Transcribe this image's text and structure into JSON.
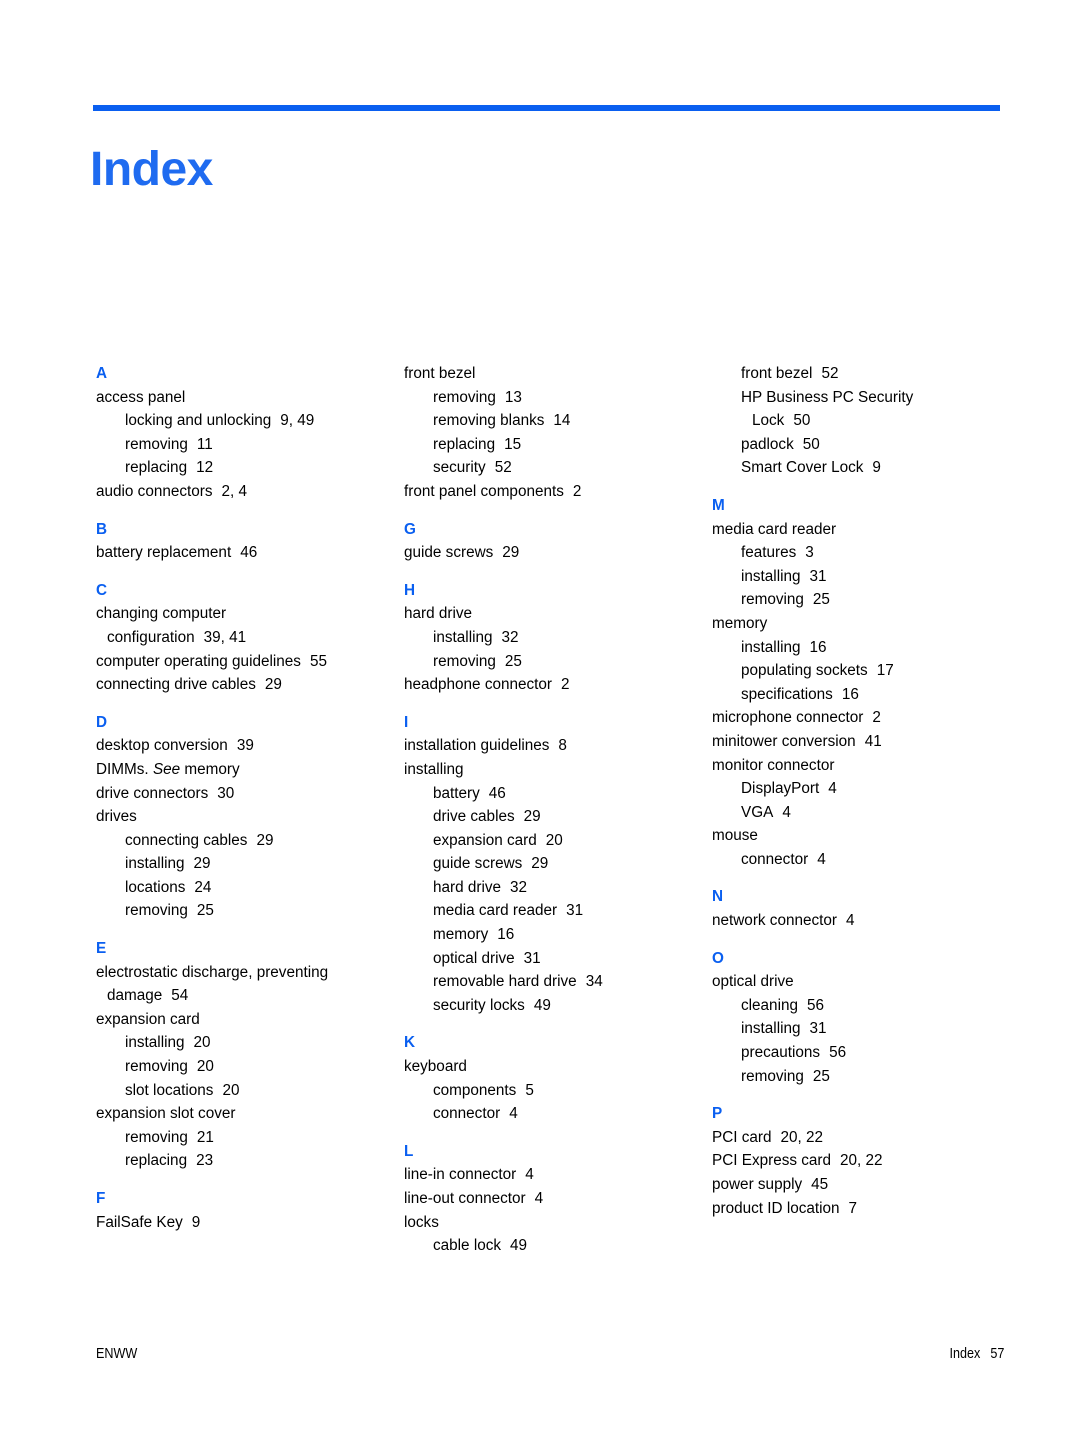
{
  "document": {
    "title": "Index",
    "accent_color": "#0a5ff0",
    "title_color": "#1f6bf0"
  },
  "footer": {
    "left": "ENWW",
    "right_label": "Index",
    "page_number": "57"
  },
  "columns": [
    {
      "id": "column-1",
      "sections": [
        {
          "letter": "A",
          "entries": [
            {
              "level": 1,
              "text": "access panel",
              "pages": ""
            },
            {
              "level": 2,
              "text": "locking and unlocking",
              "pages": "9, 49"
            },
            {
              "level": 2,
              "text": "removing",
              "pages": "11"
            },
            {
              "level": 2,
              "text": "replacing",
              "pages": "12"
            },
            {
              "level": 1,
              "text": "audio connectors",
              "pages": "2, 4"
            }
          ]
        },
        {
          "letter": "B",
          "entries": [
            {
              "level": 1,
              "text": "battery replacement",
              "pages": "46"
            }
          ]
        },
        {
          "letter": "C",
          "entries": [
            {
              "level": 1,
              "text": "changing computer",
              "pages": ""
            },
            {
              "level": 1,
              "wrap": true,
              "text": "configuration",
              "pages": "39, 41"
            },
            {
              "level": 1,
              "text": "computer operating guidelines",
              "pages": "55"
            },
            {
              "level": 1,
              "text": "connecting drive cables",
              "pages": "29"
            }
          ]
        },
        {
          "letter": "D",
          "entries": [
            {
              "level": 1,
              "text": "desktop conversion",
              "pages": "39"
            },
            {
              "level": 1,
              "text": "DIMMs. ",
              "see": "See",
              "text_after": " memory",
              "pages": ""
            },
            {
              "level": 1,
              "text": "drive connectors",
              "pages": "30"
            },
            {
              "level": 1,
              "text": "drives",
              "pages": ""
            },
            {
              "level": 2,
              "text": "connecting cables",
              "pages": "29"
            },
            {
              "level": 2,
              "text": "installing",
              "pages": "29"
            },
            {
              "level": 2,
              "text": "locations",
              "pages": "24"
            },
            {
              "level": 2,
              "text": "removing",
              "pages": "25"
            }
          ]
        },
        {
          "letter": "E",
          "entries": [
            {
              "level": 1,
              "text": "electrostatic discharge, preventing",
              "pages": ""
            },
            {
              "level": 1,
              "wrap": true,
              "text": "damage",
              "pages": "54"
            },
            {
              "level": 1,
              "text": "expansion card",
              "pages": ""
            },
            {
              "level": 2,
              "text": "installing",
              "pages": "20"
            },
            {
              "level": 2,
              "text": "removing",
              "pages": "20"
            },
            {
              "level": 2,
              "text": "slot locations",
              "pages": "20"
            },
            {
              "level": 1,
              "text": "expansion slot cover",
              "pages": ""
            },
            {
              "level": 2,
              "text": "removing",
              "pages": "21"
            },
            {
              "level": 2,
              "text": "replacing",
              "pages": "23"
            }
          ]
        },
        {
          "letter": "F",
          "entries": [
            {
              "level": 1,
              "text": "FailSafe Key",
              "pages": "9"
            }
          ]
        }
      ]
    },
    {
      "id": "column-2",
      "sections": [
        {
          "letter": "",
          "entries": [
            {
              "level": 1,
              "text": "front bezel",
              "pages": ""
            },
            {
              "level": 2,
              "text": "removing",
              "pages": "13"
            },
            {
              "level": 2,
              "text": "removing blanks",
              "pages": "14"
            },
            {
              "level": 2,
              "text": "replacing",
              "pages": "15"
            },
            {
              "level": 2,
              "text": "security",
              "pages": "52"
            },
            {
              "level": 1,
              "text": "front panel components",
              "pages": "2"
            }
          ]
        },
        {
          "letter": "G",
          "entries": [
            {
              "level": 1,
              "text": "guide screws",
              "pages": "29"
            }
          ]
        },
        {
          "letter": "H",
          "entries": [
            {
              "level": 1,
              "text": "hard drive",
              "pages": ""
            },
            {
              "level": 2,
              "text": "installing",
              "pages": "32"
            },
            {
              "level": 2,
              "text": "removing",
              "pages": "25"
            },
            {
              "level": 1,
              "text": "headphone connector",
              "pages": "2"
            }
          ]
        },
        {
          "letter": "I",
          "entries": [
            {
              "level": 1,
              "text": "installation guidelines",
              "pages": "8"
            },
            {
              "level": 1,
              "text": "installing",
              "pages": ""
            },
            {
              "level": 2,
              "text": "battery",
              "pages": "46"
            },
            {
              "level": 2,
              "text": "drive cables",
              "pages": "29"
            },
            {
              "level": 2,
              "text": "expansion card",
              "pages": "20"
            },
            {
              "level": 2,
              "text": "guide screws",
              "pages": "29"
            },
            {
              "level": 2,
              "text": "hard drive",
              "pages": "32"
            },
            {
              "level": 2,
              "text": "media card reader",
              "pages": "31"
            },
            {
              "level": 2,
              "text": "memory",
              "pages": "16"
            },
            {
              "level": 2,
              "text": "optical drive",
              "pages": "31"
            },
            {
              "level": 2,
              "text": "removable hard drive",
              "pages": "34"
            },
            {
              "level": 2,
              "text": "security locks",
              "pages": "49"
            }
          ]
        },
        {
          "letter": "K",
          "entries": [
            {
              "level": 1,
              "text": "keyboard",
              "pages": ""
            },
            {
              "level": 2,
              "text": "components",
              "pages": "5"
            },
            {
              "level": 2,
              "text": "connector",
              "pages": "4"
            }
          ]
        },
        {
          "letter": "L",
          "entries": [
            {
              "level": 1,
              "text": "line-in connector",
              "pages": "4"
            },
            {
              "level": 1,
              "text": "line-out connector",
              "pages": "4"
            },
            {
              "level": 1,
              "text": "locks",
              "pages": ""
            },
            {
              "level": 2,
              "text": "cable lock",
              "pages": "49"
            }
          ]
        }
      ]
    },
    {
      "id": "column-3",
      "sections": [
        {
          "letter": "",
          "entries": [
            {
              "level": 2,
              "text": "front bezel",
              "pages": "52"
            },
            {
              "level": 2,
              "text": "HP Business PC Security",
              "pages": ""
            },
            {
              "level": 2,
              "wrap": true,
              "text": "Lock",
              "pages": "50"
            },
            {
              "level": 2,
              "text": "padlock",
              "pages": "50"
            },
            {
              "level": 2,
              "text": "Smart Cover Lock",
              "pages": "9"
            }
          ]
        },
        {
          "letter": "M",
          "entries": [
            {
              "level": 1,
              "text": "media card reader",
              "pages": ""
            },
            {
              "level": 2,
              "text": "features",
              "pages": "3"
            },
            {
              "level": 2,
              "text": "installing",
              "pages": "31"
            },
            {
              "level": 2,
              "text": "removing",
              "pages": "25"
            },
            {
              "level": 1,
              "text": "memory",
              "pages": ""
            },
            {
              "level": 2,
              "text": "installing",
              "pages": "16"
            },
            {
              "level": 2,
              "text": "populating sockets",
              "pages": "17"
            },
            {
              "level": 2,
              "text": "specifications",
              "pages": "16"
            },
            {
              "level": 1,
              "text": "microphone connector",
              "pages": "2"
            },
            {
              "level": 1,
              "text": "minitower conversion",
              "pages": "41"
            },
            {
              "level": 1,
              "text": "monitor connector",
              "pages": ""
            },
            {
              "level": 2,
              "text": "DisplayPort",
              "pages": "4"
            },
            {
              "level": 2,
              "text": "VGA",
              "pages": "4"
            },
            {
              "level": 1,
              "text": "mouse",
              "pages": ""
            },
            {
              "level": 2,
              "text": "connector",
              "pages": "4"
            }
          ]
        },
        {
          "letter": "N",
          "entries": [
            {
              "level": 1,
              "text": "network connector",
              "pages": "4"
            }
          ]
        },
        {
          "letter": "O",
          "entries": [
            {
              "level": 1,
              "text": "optical drive",
              "pages": ""
            },
            {
              "level": 2,
              "text": "cleaning",
              "pages": "56"
            },
            {
              "level": 2,
              "text": "installing",
              "pages": "31"
            },
            {
              "level": 2,
              "text": "precautions",
              "pages": "56"
            },
            {
              "level": 2,
              "text": "removing",
              "pages": "25"
            }
          ]
        },
        {
          "letter": "P",
          "entries": [
            {
              "level": 1,
              "text": "PCI card",
              "pages": "20, 22"
            },
            {
              "level": 1,
              "text": "PCI Express card",
              "pages": "20, 22"
            },
            {
              "level": 1,
              "text": "power supply",
              "pages": "45"
            },
            {
              "level": 1,
              "text": "product ID location",
              "pages": "7"
            }
          ]
        }
      ]
    }
  ]
}
